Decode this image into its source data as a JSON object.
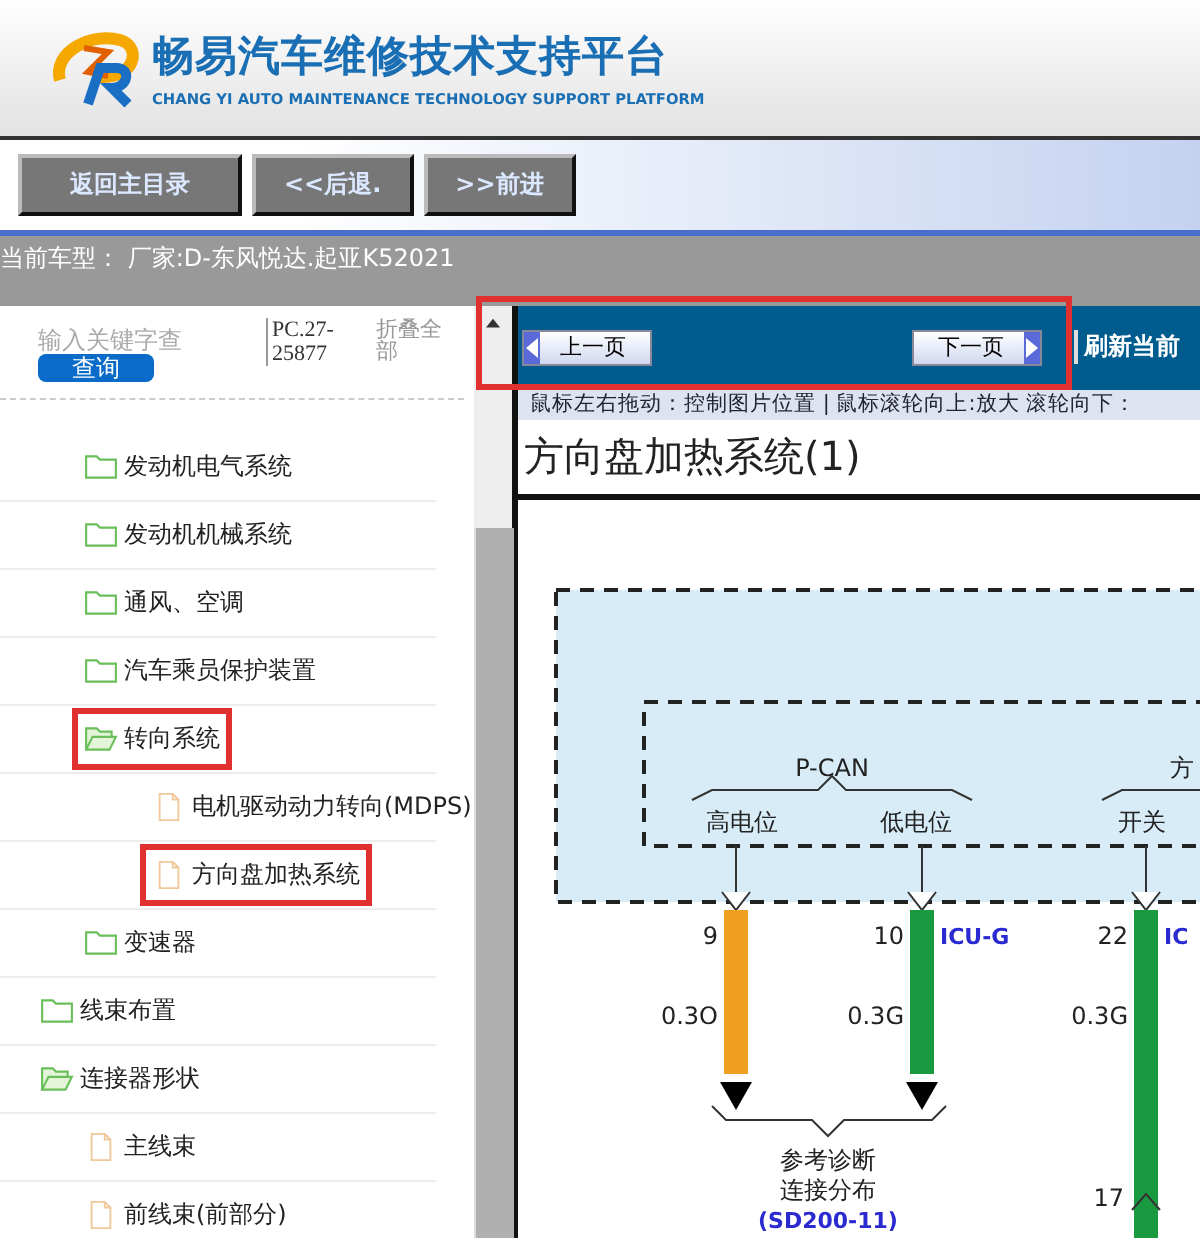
{
  "header": {
    "title": "畅易汽车维修技术支持平台",
    "subtitle": "CHANG YI AUTO MAINTENANCE TECHNOLOGY SUPPORT PLATFORM"
  },
  "toolbar": {
    "buttons": [
      "返回主目录",
      "<<后退.",
      ">>前进"
    ]
  },
  "status": "当前车型： 厂家:D-东风悦达.起亚K52021",
  "sidebar": {
    "search": {
      "placeholder": "输入关键字查"
    },
    "search_button": "查询",
    "code": "PC.27-25877",
    "collapse_all": "折叠全部",
    "tree": [
      {
        "children": [
          {
            "kind": "folder",
            "label": "发动机电气系统",
            "expanded": false,
            "highlighted": false
          },
          {
            "kind": "folder",
            "label": "发动机机械系统",
            "expanded": false,
            "highlighted": false
          },
          {
            "kind": "folder",
            "label": "通风、空调",
            "expanded": false,
            "highlighted": false
          },
          {
            "kind": "folder",
            "label": "汽车乘员保护装置",
            "expanded": false,
            "highlighted": false
          },
          {
            "kind": "folder",
            "label": "转向系统",
            "expanded": true,
            "highlighted": true,
            "children": [
              {
                "kind": "page",
                "label": "电机驱动动力转向(MDPS)",
                "highlighted": false
              },
              {
                "kind": "page",
                "label": "方向盘加热系统",
                "highlighted": true
              }
            ]
          },
          {
            "kind": "folder",
            "label": "变速器",
            "expanded": false,
            "highlighted": false
          }
        ]
      },
      {
        "kind": "folder",
        "label": "线束布置",
        "expanded": false,
        "highlighted": false
      },
      {
        "kind": "folder",
        "label": "连接器形状",
        "expanded": true,
        "highlighted": false,
        "children": [
          {
            "kind": "page",
            "label": "主线束",
            "highlighted": false
          },
          {
            "kind": "page",
            "label": "前线束(前部分)",
            "highlighted": false
          }
        ]
      }
    ]
  },
  "viewer": {
    "nav": {
      "highlighted": true,
      "prev": "上一页",
      "next": "下一页",
      "refresh": "刷新当前"
    },
    "hint": "鼠标左右拖动：控制图片位置 | 鼠标滚轮向上:放大   滚轮向下：",
    "title": "方向盘加热系统(1)",
    "diagram": {
      "bus": "P-CAN",
      "bus_lines": [
        "高电位",
        "低电位"
      ],
      "group": "方",
      "group_line": "开关",
      "pins": [
        {
          "number": "9",
          "wire": "0.3O",
          "color": "#f0a020",
          "terminated": true
        },
        {
          "number": "10",
          "wire": "0.3G",
          "color": "#1a9a40",
          "connector": "ICU-G",
          "terminated": true
        },
        {
          "number": "22",
          "wire": "0.3G",
          "color": "#1a9a40",
          "connector": "IC",
          "terminated": false
        }
      ],
      "reference": [
        "参考诊断",
        "连接分布",
        "(SD200-11)"
      ],
      "lower_pin": "17"
    }
  }
}
